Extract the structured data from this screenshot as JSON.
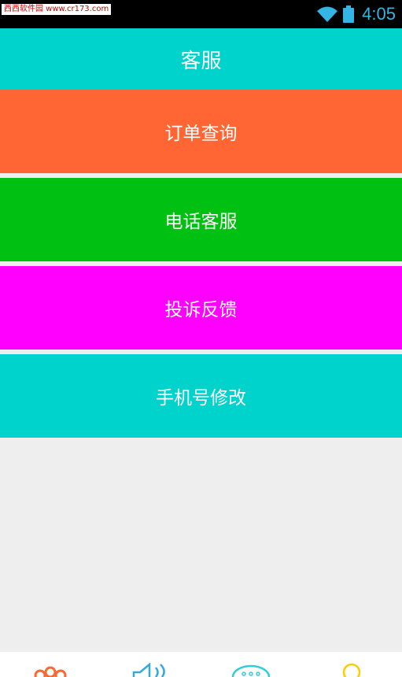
{
  "status_bar": {
    "watermark": "西西软件园 www.cr173.com",
    "time": "4:05",
    "icons": [
      "wifi-icon",
      "battery-icon"
    ],
    "time_color": "#33b5e5"
  },
  "header": {
    "title": "客服",
    "background": "#00d3cb"
  },
  "menu": {
    "items": [
      {
        "label": "订单查询",
        "color": "#ff6633"
      },
      {
        "label": "电话客服",
        "color": "#00c012"
      },
      {
        "label": "投诉反馈",
        "color": "#ff00ff"
      },
      {
        "label": "手机号修改",
        "color": "#00d3cb"
      }
    ]
  },
  "bottom_nav": {
    "icons": [
      {
        "name": "flower-icon",
        "color": "#ff6633"
      },
      {
        "name": "speaker-icon",
        "color": "#33aadd"
      },
      {
        "name": "chat-bubble-icon",
        "color": "#33ccdd"
      },
      {
        "name": "user-icon",
        "color": "#ffcc00"
      }
    ]
  }
}
